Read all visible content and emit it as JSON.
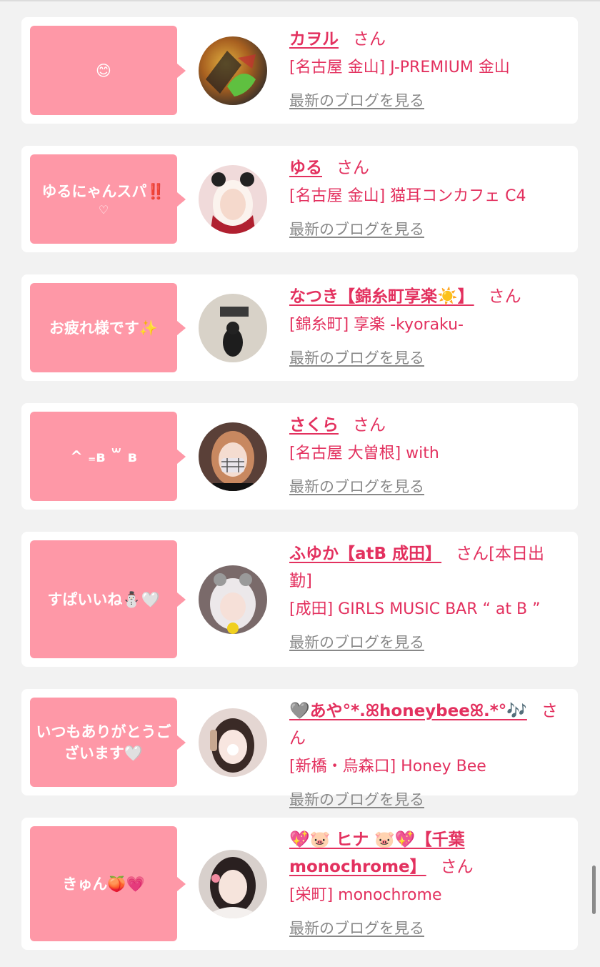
{
  "san_label": "さん",
  "blog_label": "最新のブログを見る",
  "colors": {
    "bubble": "#fe98a7",
    "accent": "#e3315f",
    "link_gray": "#888888",
    "background": "#f2f2f2"
  },
  "cards": [
    {
      "bubble": "😊",
      "bubble_sub": "",
      "name": "カヲル",
      "shop": "[名古屋 金山] J-PREMIUM 金山",
      "avatar_icon": "avatar-photo"
    },
    {
      "bubble": "ゆるにゃんスパ‼️",
      "bubble_sub": "♡",
      "name": "ゆる",
      "shop": "[名古屋 金山] 猫耳コンカフェ C4",
      "avatar_icon": "avatar-photo"
    },
    {
      "bubble": "お疲れ様です✨",
      "bubble_sub": "",
      "name": "なつき【錦糸町享楽☀️】",
      "shop": "[錦糸町] 享楽 -kyoraku-",
      "avatar_icon": "avatar-photo"
    },
    {
      "bubble": "^ ₌ʙ ꒳ ʙ",
      "bubble_sub": "",
      "name": "さくら",
      "shop": "[名古屋 大曽根] with",
      "avatar_icon": "avatar-photo"
    },
    {
      "bubble": "すぱいいね⛄🤍",
      "bubble_sub": "",
      "name": "ふゆか【atB 成田】",
      "name_suffix": "[本日出勤]",
      "shop": "[成田] GIRLS MUSIC BAR “ at B ”",
      "avatar_icon": "avatar-photo"
    },
    {
      "bubble": "いつもありがとうございます🤍",
      "bubble_sub": "",
      "name": "🩶あや°*.ꕤhoneybeeꕤ.*°🎶",
      "shop": "[新橋・烏森口] Honey Bee",
      "avatar_icon": "avatar-photo"
    },
    {
      "bubble": "きゅん🍑💗",
      "bubble_sub": "",
      "name": "💖🐷 ヒナ 🐷💖【千葉 monochrome】",
      "shop": "[栄町] monochrome",
      "avatar_icon": "avatar-photo"
    }
  ]
}
